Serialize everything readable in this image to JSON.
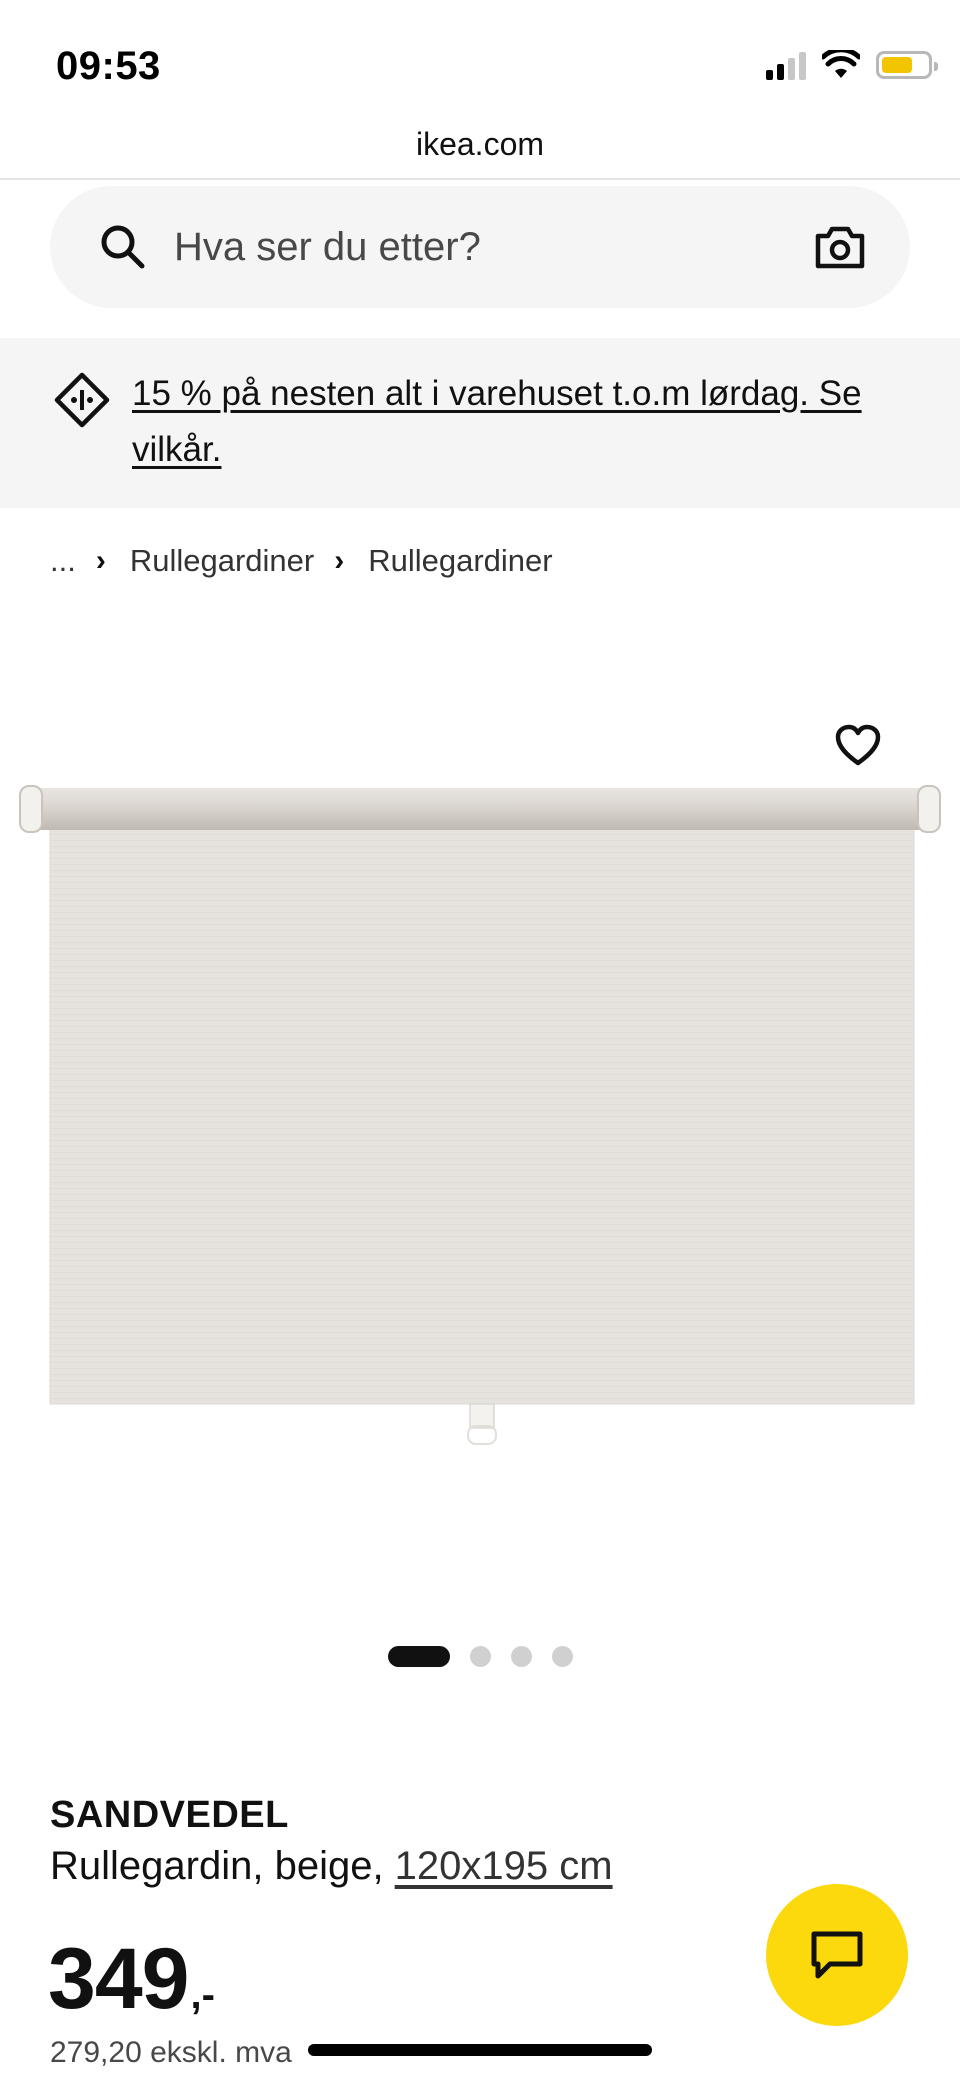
{
  "status_bar": {
    "time": "09:53"
  },
  "browser": {
    "url": "ikea.com"
  },
  "search": {
    "placeholder": "Hva ser du etter?"
  },
  "promo": {
    "text": "15 % på nesten alt i varehuset t.o.m lørdag. Se vilkår."
  },
  "breadcrumb": {
    "items": [
      {
        "label": "..."
      },
      {
        "label": "Rullegardiner"
      },
      {
        "label": "Rullegardiner"
      }
    ]
  },
  "gallery": {
    "current_index": 1,
    "count": 4
  },
  "product": {
    "name": "SANDVEDEL",
    "description": "Rullegardin, beige, ",
    "size": "120x195 cm",
    "price": "349",
    "price_suffix": ",-",
    "price_ex_vat": "279,20 ekskl. mva"
  },
  "colors": {
    "brand_yellow": "#fcd90c",
    "surface_gray": "#f5f5f5",
    "fabric_beige": "#e7e3de"
  },
  "icons": [
    "search-icon",
    "camera-icon",
    "promo-tag-icon",
    "chevron-right-icon",
    "heart-icon",
    "chat-icon"
  ]
}
